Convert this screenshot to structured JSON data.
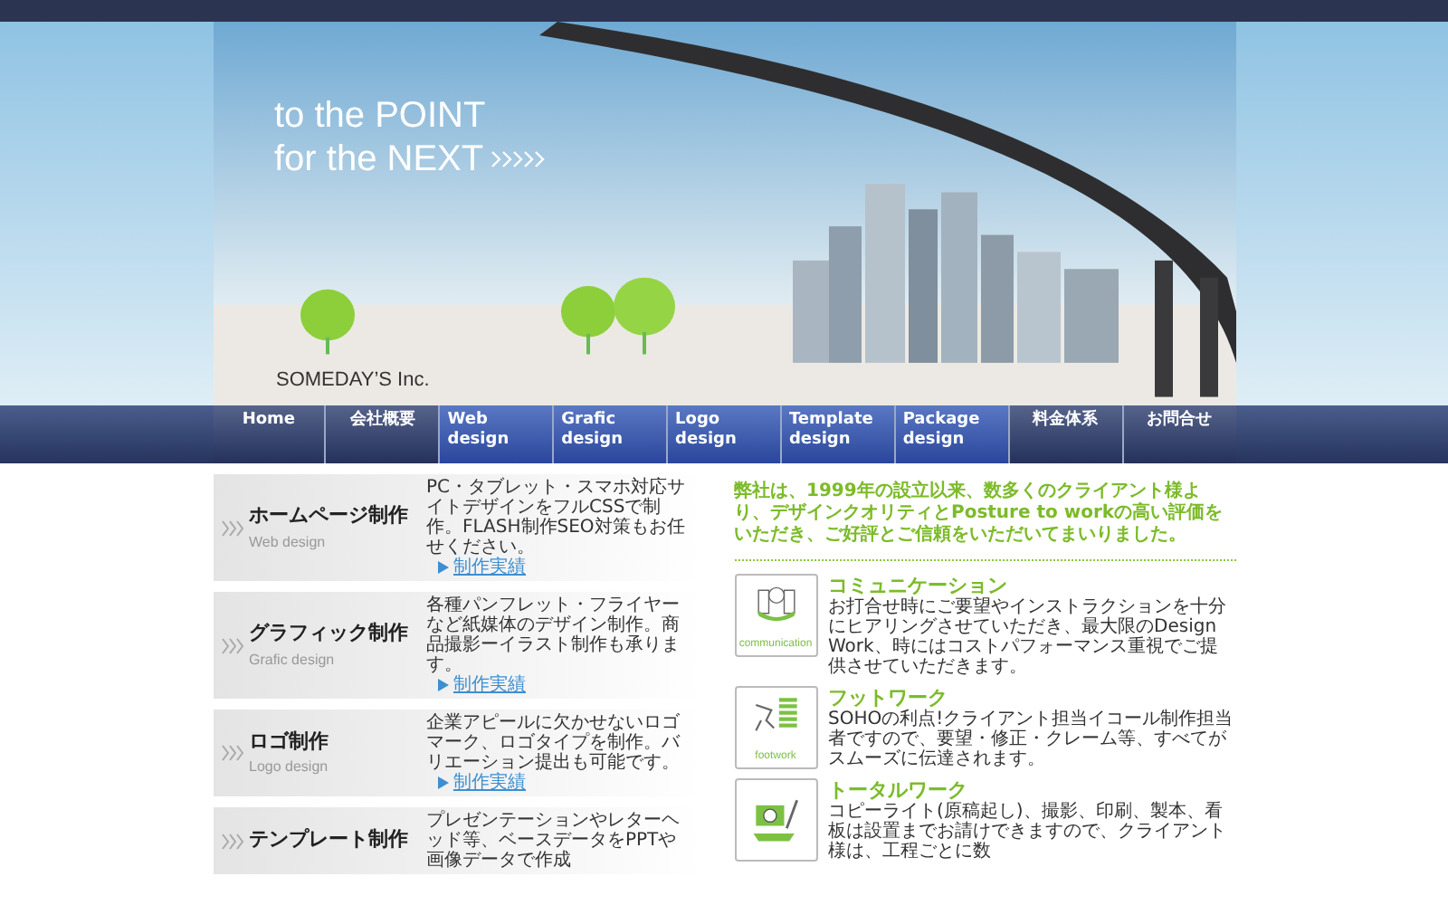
{
  "hero": {
    "tagline_1": "to the POINT",
    "tagline_2": "for the NEXT",
    "company": "SOMEDAY’S Inc."
  },
  "nav": [
    {
      "label": "Home",
      "kind": "page"
    },
    {
      "label": "会社概要",
      "kind": "page"
    },
    {
      "label": "Web design",
      "kind": "service"
    },
    {
      "label": "Grafic design",
      "kind": "service"
    },
    {
      "label": "Logo design",
      "kind": "service"
    },
    {
      "label": "Template design",
      "kind": "service"
    },
    {
      "label": "Package design",
      "kind": "service"
    },
    {
      "label": "料金体系",
      "kind": "page"
    },
    {
      "label": "お問合せ",
      "kind": "page"
    }
  ],
  "services": [
    {
      "title": "ホームページ制作",
      "subtitle": "Web design",
      "description": "PC・タブレット・スマホ対応サイトデザインをフルCSSで制作。FLASH制作SEO対策もお任せください。",
      "link": "制作実績"
    },
    {
      "title": "グラフィック制作",
      "subtitle": "Grafic design",
      "description": "各種パンフレット・フライヤーなど紙媒体のデザイン制作。商品撮影ーイラスト制作も承ります。",
      "link": "制作実績"
    },
    {
      "title": "ロゴ制作",
      "subtitle": "Logo design",
      "description": "企業アピールに欠かせないロゴマーク、ロゴタイプを制作。バリエーション提出も可能です。",
      "link": "制作実績"
    },
    {
      "title": "テンプレート制作",
      "description": "プレゼンテーションやレターヘッド等、ベースデータをPPTや画像データで作成"
    }
  ],
  "intro": "弊社は、1999年の設立以来、数多くのクライアント様より、デザインクオリティとPosture to workの高い評価をいただき、ご好評とご信頼をいただいてまいりました。",
  "features": [
    {
      "kind": "communication",
      "title": "コミュニケーション",
      "icon_label": "communication",
      "text": "お打合せ時にご要望やインストラクションを十分にヒアリングさせていただき、最大限のDesign Work、時にはコストパフォーマンス重視でご提供させていただきます。"
    },
    {
      "kind": "footwork",
      "title": "フットワーク",
      "icon_label": "footwork",
      "text": "SOHOの利点!クライアント担当イコール制作担当者ですので、要望・修正・クレーム等、すべてがスムーズに伝達されます。"
    },
    {
      "kind": "total",
      "title": "トータルワーク",
      "text": "コピーライト(原稿起し)、撮影、印刷、製本、看板は設置までお請けできますので、クライアント様は、工程ごとに数"
    }
  ]
}
